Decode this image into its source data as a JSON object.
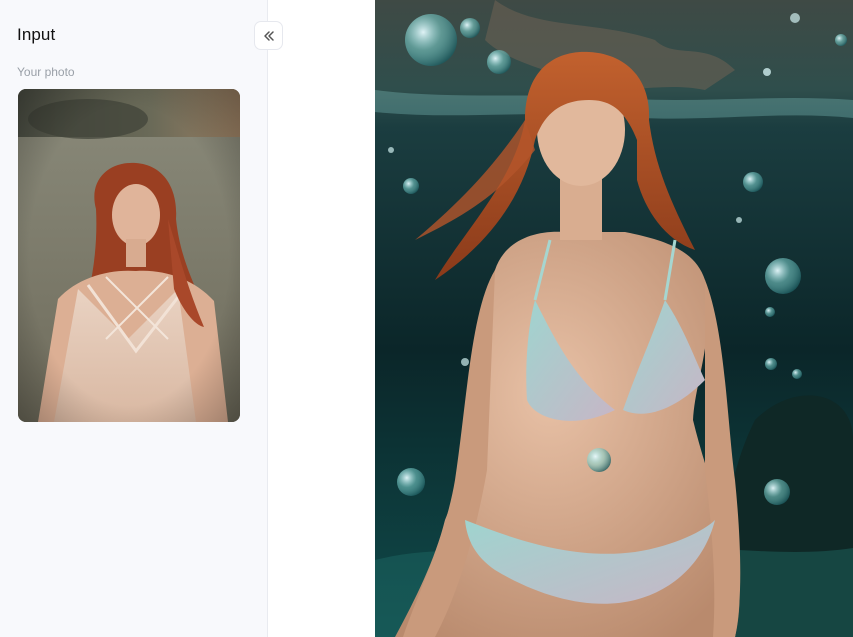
{
  "sidebar": {
    "title": "Input",
    "section_label": "Your photo",
    "collapse_icon": "double-chevron-left-icon"
  },
  "input_photo": {
    "description_icon": "uploaded-photo"
  },
  "result_image": {
    "icon": "generated-image"
  }
}
